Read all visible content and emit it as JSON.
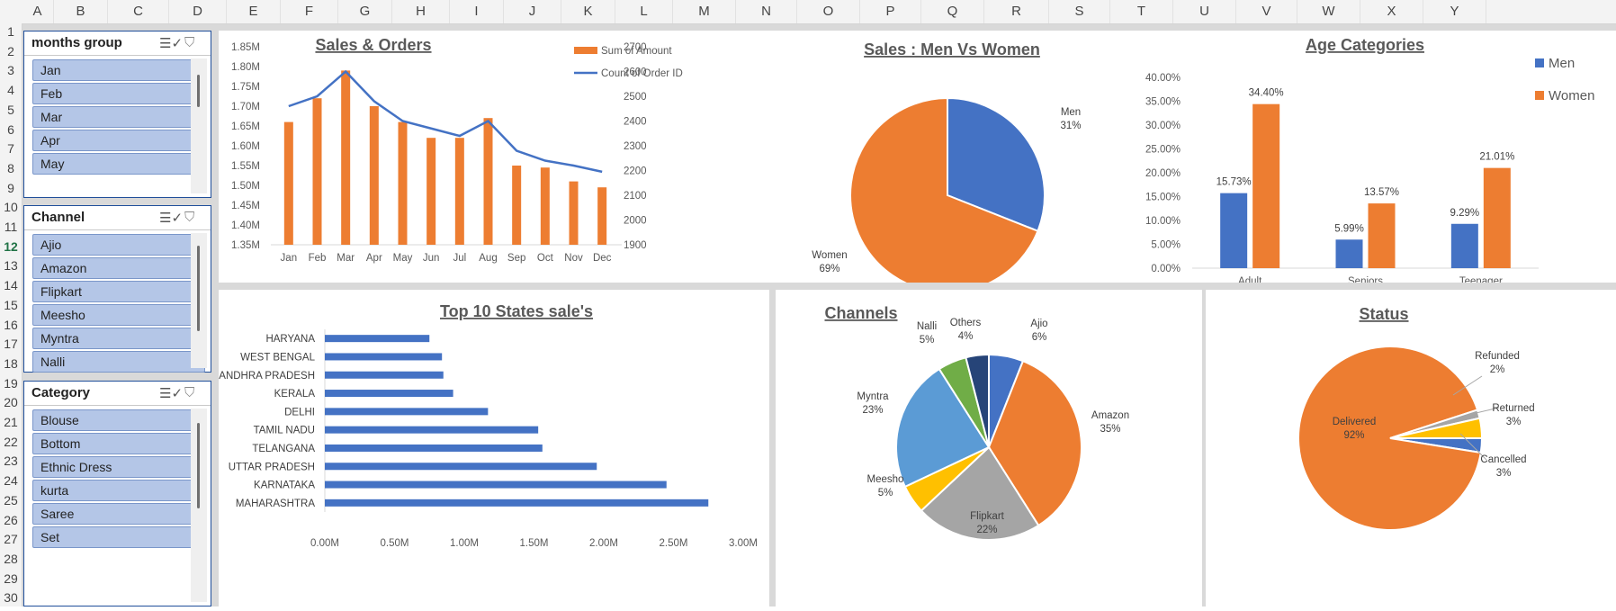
{
  "columns": [
    "A",
    "B",
    "C",
    "D",
    "E",
    "F",
    "G",
    "H",
    "I",
    "J",
    "K",
    "L",
    "M",
    "N",
    "O",
    "P",
    "Q",
    "R",
    "S",
    "T",
    "U",
    "V",
    "W",
    "X",
    "Y"
  ],
  "rows": [
    "1",
    "2",
    "3",
    "4",
    "5",
    "6",
    "7",
    "8",
    "9",
    "10",
    "11",
    "12",
    "13",
    "14",
    "15",
    "16",
    "17",
    "18",
    "19",
    "20",
    "21",
    "22",
    "23",
    "24",
    "25",
    "26",
    "27",
    "28",
    "29",
    "30"
  ],
  "selected_row": "12",
  "slicers": [
    {
      "title": "months group",
      "items": [
        "Jan",
        "Feb",
        "Mar",
        "Apr",
        "May"
      ]
    },
    {
      "title": "Channel",
      "items": [
        "Ajio",
        "Amazon",
        "Flipkart",
        "Meesho",
        "Myntra",
        "Nalli"
      ]
    },
    {
      "title": "Category",
      "items": [
        "Blouse",
        "Bottom",
        "Ethnic Dress",
        "kurta",
        "Saree",
        "Set"
      ]
    }
  ],
  "icons": {
    "multi_select": "multi-select-icon",
    "clear_filter": "clear-filter-icon"
  },
  "chart_data": [
    {
      "id": "sales_orders",
      "type": "bar",
      "title": "Sales & Orders",
      "categories": [
        "Jan",
        "Feb",
        "Mar",
        "Apr",
        "May",
        "Jun",
        "Jul",
        "Aug",
        "Sep",
        "Oct",
        "Nov",
        "Dec"
      ],
      "series": [
        {
          "name": "Sum of Amount",
          "type": "bar",
          "color": "#ed7d31",
          "values": [
            1.66,
            1.72,
            1.79,
            1.7,
            1.66,
            1.62,
            1.62,
            1.67,
            1.55,
            1.545,
            1.51,
            1.495
          ]
        },
        {
          "name": "Count of Order ID",
          "type": "line",
          "axis": "secondary",
          "color": "#4472c4",
          "values": [
            2460,
            2500,
            2600,
            2480,
            2400,
            2370,
            2340,
            2400,
            2280,
            2240,
            2220,
            2195
          ]
        }
      ],
      "y_ticks": [
        "1.35M",
        "1.40M",
        "1.45M",
        "1.50M",
        "1.55M",
        "1.60M",
        "1.65M",
        "1.70M",
        "1.75M",
        "1.80M",
        "1.85M"
      ],
      "ylim": [
        1.35,
        1.85
      ],
      "y2_ticks": [
        "1900",
        "2000",
        "2100",
        "2200",
        "2300",
        "2400",
        "2500",
        "2600",
        "2700"
      ],
      "y2lim": [
        1900,
        2700
      ],
      "legend": "top-right"
    },
    {
      "id": "men_women",
      "type": "pie",
      "title": "Sales : Men Vs Women",
      "slices": [
        {
          "label": "Men",
          "pct_label": "31%",
          "value": 31,
          "color": "#4472c4"
        },
        {
          "label": "Women",
          "pct_label": "69%",
          "value": 69,
          "color": "#ed7d31"
        }
      ]
    },
    {
      "id": "age",
      "type": "bar",
      "title": "Age Categories",
      "categories": [
        "Adult",
        "Seniors",
        "Teenager"
      ],
      "series": [
        {
          "name": "Men",
          "color": "#4472c4",
          "values": [
            15.73,
            5.99,
            9.29
          ],
          "labels": [
            "15.73%",
            "5.99%",
            "9.29%"
          ]
        },
        {
          "name": "Women",
          "color": "#ed7d31",
          "values": [
            34.4,
            13.57,
            21.01
          ],
          "labels": [
            "34.40%",
            "13.57%",
            "21.01%"
          ]
        }
      ],
      "y_ticks": [
        "0.00%",
        "5.00%",
        "10.00%",
        "15.00%",
        "20.00%",
        "25.00%",
        "30.00%",
        "35.00%",
        "40.00%"
      ],
      "ylim": [
        0,
        40
      ],
      "legend": "right"
    },
    {
      "id": "states",
      "type": "bar",
      "orientation": "horizontal",
      "title": "Top 10 States sale's",
      "categories": [
        "HARYANA",
        "WEST BENGAL",
        "ANDHRA PRADESH",
        "KERALA",
        "DELHI",
        "TAMIL NADU",
        "TELANGANA",
        "UTTAR PRADESH",
        "KARNATAKA",
        "MAHARASHTRA"
      ],
      "values": [
        0.75,
        0.84,
        0.85,
        0.92,
        1.17,
        1.53,
        1.56,
        1.95,
        2.45,
        2.75
      ],
      "color": "#4472c4",
      "x_ticks": [
        "0.00M",
        "0.50M",
        "1.00M",
        "1.50M",
        "2.00M",
        "2.50M",
        "3.00M"
      ],
      "xlim": [
        0,
        3
      ]
    },
    {
      "id": "channels",
      "type": "pie",
      "title": "Channels",
      "slices": [
        {
          "label": "Ajio",
          "pct_label": "6%",
          "value": 6,
          "color": "#4472c4"
        },
        {
          "label": "Amazon",
          "pct_label": "35%",
          "value": 35,
          "color": "#ed7d31"
        },
        {
          "label": "Flipkart",
          "pct_label": "22%",
          "value": 22,
          "color": "#a5a5a5"
        },
        {
          "label": "Meesho",
          "pct_label": "5%",
          "value": 5,
          "color": "#ffc000"
        },
        {
          "label": "Myntra",
          "pct_label": "23%",
          "value": 23,
          "color": "#5b9bd5"
        },
        {
          "label": "Nalli",
          "pct_label": "5%",
          "value": 5,
          "color": "#70ad47"
        },
        {
          "label": "Others",
          "pct_label": "4%",
          "value": 4,
          "color": "#264478"
        }
      ]
    },
    {
      "id": "status",
      "type": "pie",
      "title": "Status",
      "slices": [
        {
          "label": "Cancelled",
          "pct_label": "3%",
          "value": 2.5,
          "color": "#4472c4"
        },
        {
          "label": "Delivered",
          "pct_label": "92%",
          "value": 92.5,
          "color": "#ed7d31"
        },
        {
          "label": "Refunded",
          "pct_label": "2%",
          "value": 1.5,
          "color": "#a5a5a5"
        },
        {
          "label": "Returned",
          "pct_label": "3%",
          "value": 3.5,
          "color": "#ffc000"
        }
      ]
    }
  ]
}
